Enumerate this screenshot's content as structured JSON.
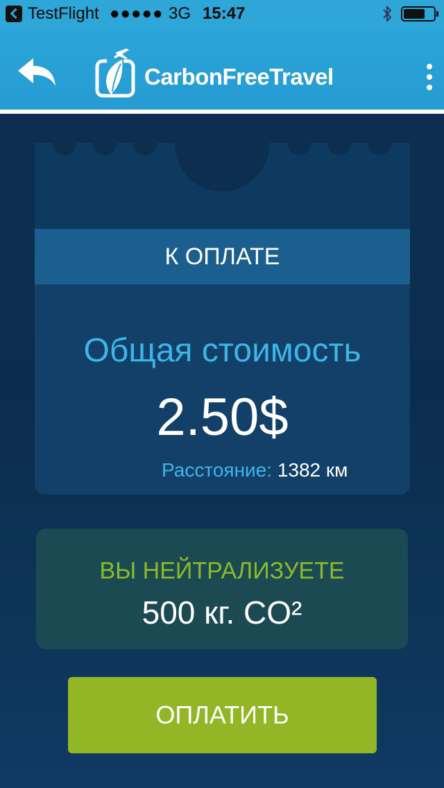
{
  "status_bar": {
    "carrier": "TestFlight",
    "signal": "●●●●●",
    "network": "3G",
    "time": "15:47"
  },
  "header": {
    "app_title": "CarbonFreeTravel",
    "icons": {
      "back": "back-arrow-icon",
      "logo": "leaf-plane-logo-icon",
      "menu": "more-vertical-icon"
    }
  },
  "ticket": {
    "band_label": "К ОПЛАТЕ",
    "total_label": "Общая стоимость",
    "total_value": "2.50$",
    "distance_label": "Расстояние:",
    "distance_value": "1382 км"
  },
  "neutralize": {
    "label": "ВЫ НЕЙТРАЛИЗУЕТЕ",
    "value": "500 кг. CO²"
  },
  "pay_button": {
    "label": "ОПЛАТИТЬ"
  },
  "colors": {
    "header_blue": "#2ba5d9",
    "background_navy": "#0e2f52",
    "accent_cyan": "#3db5e8",
    "accent_green": "#93b626"
  }
}
